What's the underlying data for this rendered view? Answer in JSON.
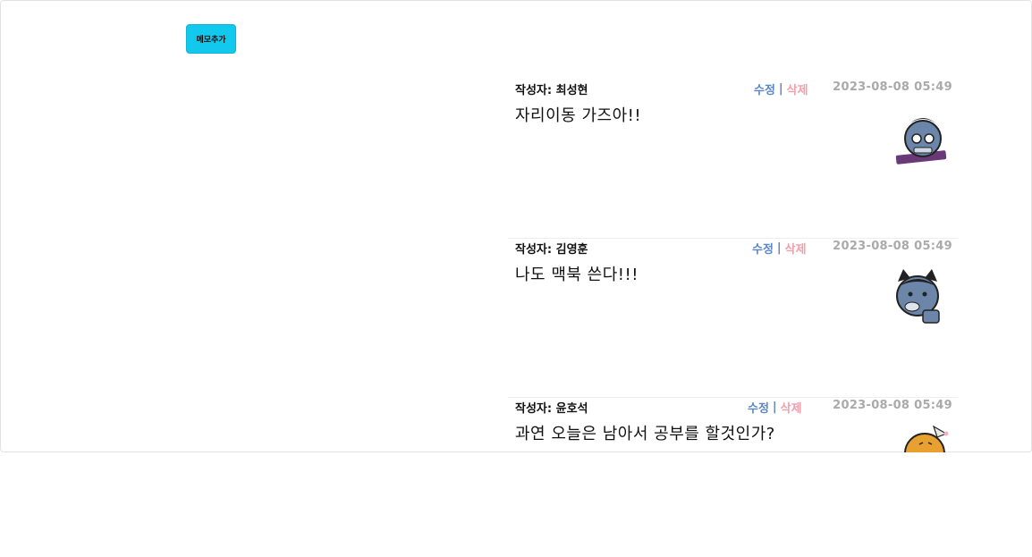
{
  "toolbar": {
    "add_memo_label": "메모추가"
  },
  "memos": [
    {
      "author": "작성자: 최성현",
      "edit_label": "수정",
      "separator": "|",
      "delete_label": "삭제",
      "date": "2023-08-08 05:49",
      "content": "자리이동 가즈아!!",
      "sticker": "ryan-laptop-sticker"
    },
    {
      "author": "작성자: 김영훈",
      "edit_label": "수정",
      "separator": "|",
      "delete_label": "삭제",
      "date": "2023-08-08 05:49",
      "content": "나도 맥북 쓴다!!!",
      "sticker": "ryan-cat-sticker"
    },
    {
      "author": "작성자: 윤호석",
      "edit_label": "수정",
      "separator": "|",
      "delete_label": "삭제",
      "date": "2023-08-08 05:49",
      "content": "과연 오늘은 남아서 공부를 할것인가?",
      "sticker": "ryan-party-hat-sticker"
    }
  ],
  "colors": {
    "add_button": "#12c8ec",
    "edit": "#5a86c8",
    "delete": "#f0a0aa",
    "date": "#aaaaaa"
  }
}
